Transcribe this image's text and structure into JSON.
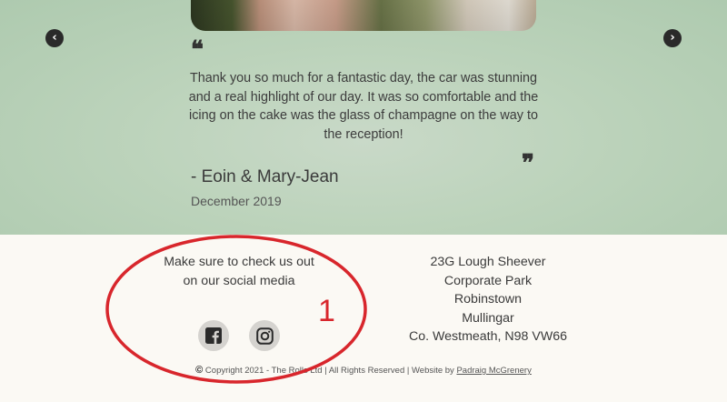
{
  "carousel": {
    "prev_icon": "chevron-left-circle-icon",
    "next_icon": "chevron-right-circle-icon",
    "prev_glyph": "‹",
    "next_glyph": "›"
  },
  "testimonial": {
    "quote_open": "❝",
    "quote_close": "❞",
    "text": "Thank you so much for a fantastic day, the car was stunning and a real highlight of our day. It was so comfortable and the icing on the cake was the glass of champagne on the way to the reception!",
    "author": "- Eoin & Mary-Jean",
    "date": "December 2019"
  },
  "footer": {
    "social_text": "Make sure to check us out on our social media",
    "social_icons": [
      "facebook-icon",
      "instagram-icon"
    ],
    "address": [
      "23G Lough Sheever",
      "Corporate Park",
      "Robinstown",
      "Mullingar",
      "Co. Westmeath, N98 VW66"
    ],
    "copyright_symbol": "©",
    "copyright_text": "Copyright 2021 - The Rolls Ltd | All Rights Reserved | Website by",
    "credit_link": "Padraig McGrenery"
  },
  "annotation": {
    "number": "1",
    "color": "#d8262c"
  },
  "colors": {
    "testimonial_bg": "#bcd3bb",
    "footer_bg": "#fbf9f4",
    "icon_bg": "#d5d3cf"
  }
}
